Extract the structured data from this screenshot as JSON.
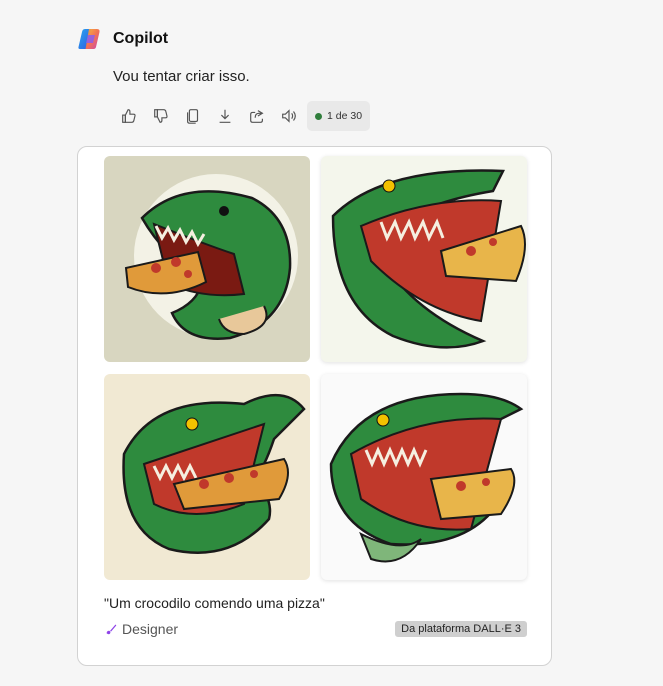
{
  "app": {
    "name": "Copilot"
  },
  "message": {
    "text": "Vou tentar criar isso."
  },
  "actions": {
    "icons": [
      "thumbs-up-icon",
      "thumbs-down-icon",
      "copy-icon",
      "download-icon",
      "share-icon",
      "speaker-icon"
    ],
    "counter": "1 de 30",
    "counter_dot_color": "#2f7d3b"
  },
  "result": {
    "images": [
      {
        "subject": "crocodile-eating-pizza",
        "background": "#d8d6c0"
      },
      {
        "subject": "crocodile-eating-pizza",
        "background": "#f4f6ec"
      },
      {
        "subject": "crocodile-eating-pizza",
        "background": "#f1e9d3"
      },
      {
        "subject": "crocodile-eating-pizza",
        "background": "#fafafa"
      }
    ],
    "prompt": "\"Um crocodilo comendo uma pizza\"",
    "designer_label": "Designer",
    "source_badge": "Da plataforma DALL·E 3"
  }
}
